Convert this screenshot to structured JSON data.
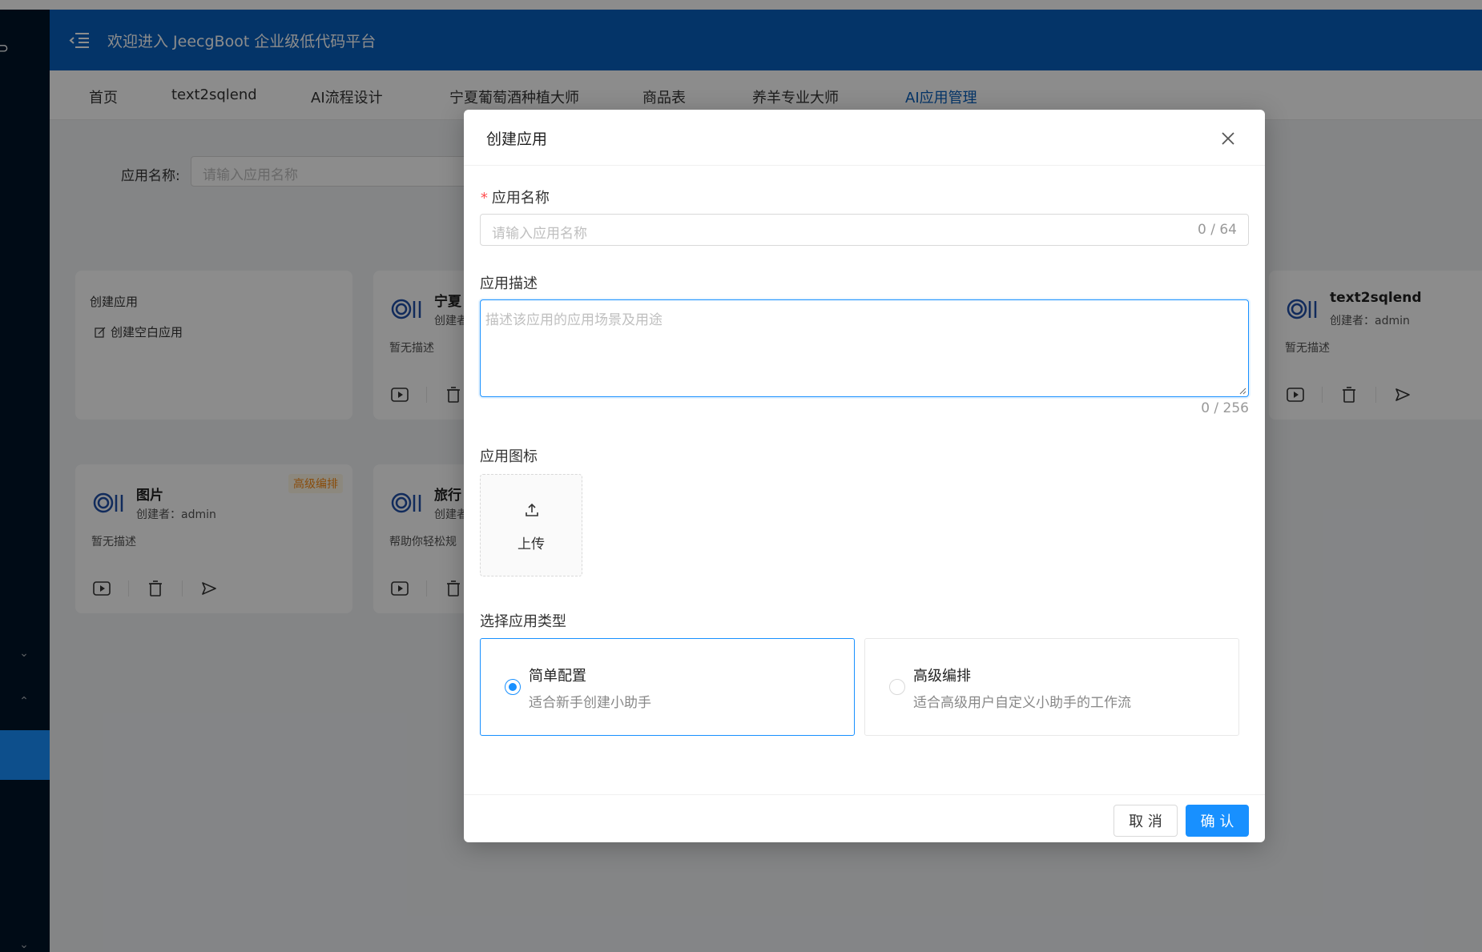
{
  "header": {
    "title": "欢迎进入 JeecgBoot 企业级低代码平台"
  },
  "tabs": [
    {
      "label": "首页"
    },
    {
      "label": "text2sqlend"
    },
    {
      "label": "AI流程设计"
    },
    {
      "label": "宁夏葡萄酒种植大师"
    },
    {
      "label": "商品表"
    },
    {
      "label": "养羊专业大师"
    },
    {
      "label": "AI应用管理"
    }
  ],
  "search": {
    "label": "应用名称:",
    "placeholder": "请输入应用名称"
  },
  "cards": {
    "create": {
      "title": "创建应用",
      "link": "创建空白应用"
    },
    "ningxia": {
      "title": "宁夏",
      "creator": "创建者",
      "desc": "暂无描述"
    },
    "text2sql": {
      "title": "text2sqlend",
      "creator": "创建者：admin",
      "desc": "暂无描述"
    },
    "image": {
      "title": "图片",
      "creator": "创建者：admin",
      "desc": "暂无描述",
      "tag": "高级编排"
    },
    "travel": {
      "title": "旅行",
      "creator": "创建者",
      "desc": "帮助你轻松规"
    }
  },
  "modal": {
    "title": "创建应用",
    "name_label": "应用名称",
    "name_placeholder": "请输入应用名称",
    "name_count": "0 / 64",
    "desc_label": "应用描述",
    "desc_placeholder": "描述该应用的应用场景及用途",
    "desc_count": "0 / 256",
    "icon_label": "应用图标",
    "upload_text": "上传",
    "type_label": "选择应用类型",
    "types": [
      {
        "name": "简单配置",
        "desc": "适合新手创建小助手",
        "selected": true
      },
      {
        "name": "高级编排",
        "desc": "适合高级用户自定义小助手的工作流",
        "selected": false
      }
    ],
    "cancel": "取 消",
    "ok": "确 认"
  },
  "colors": {
    "primary": "#1890ff",
    "header": "#0960bd",
    "sidebar": "#001529",
    "tag": "#fa8c16"
  }
}
